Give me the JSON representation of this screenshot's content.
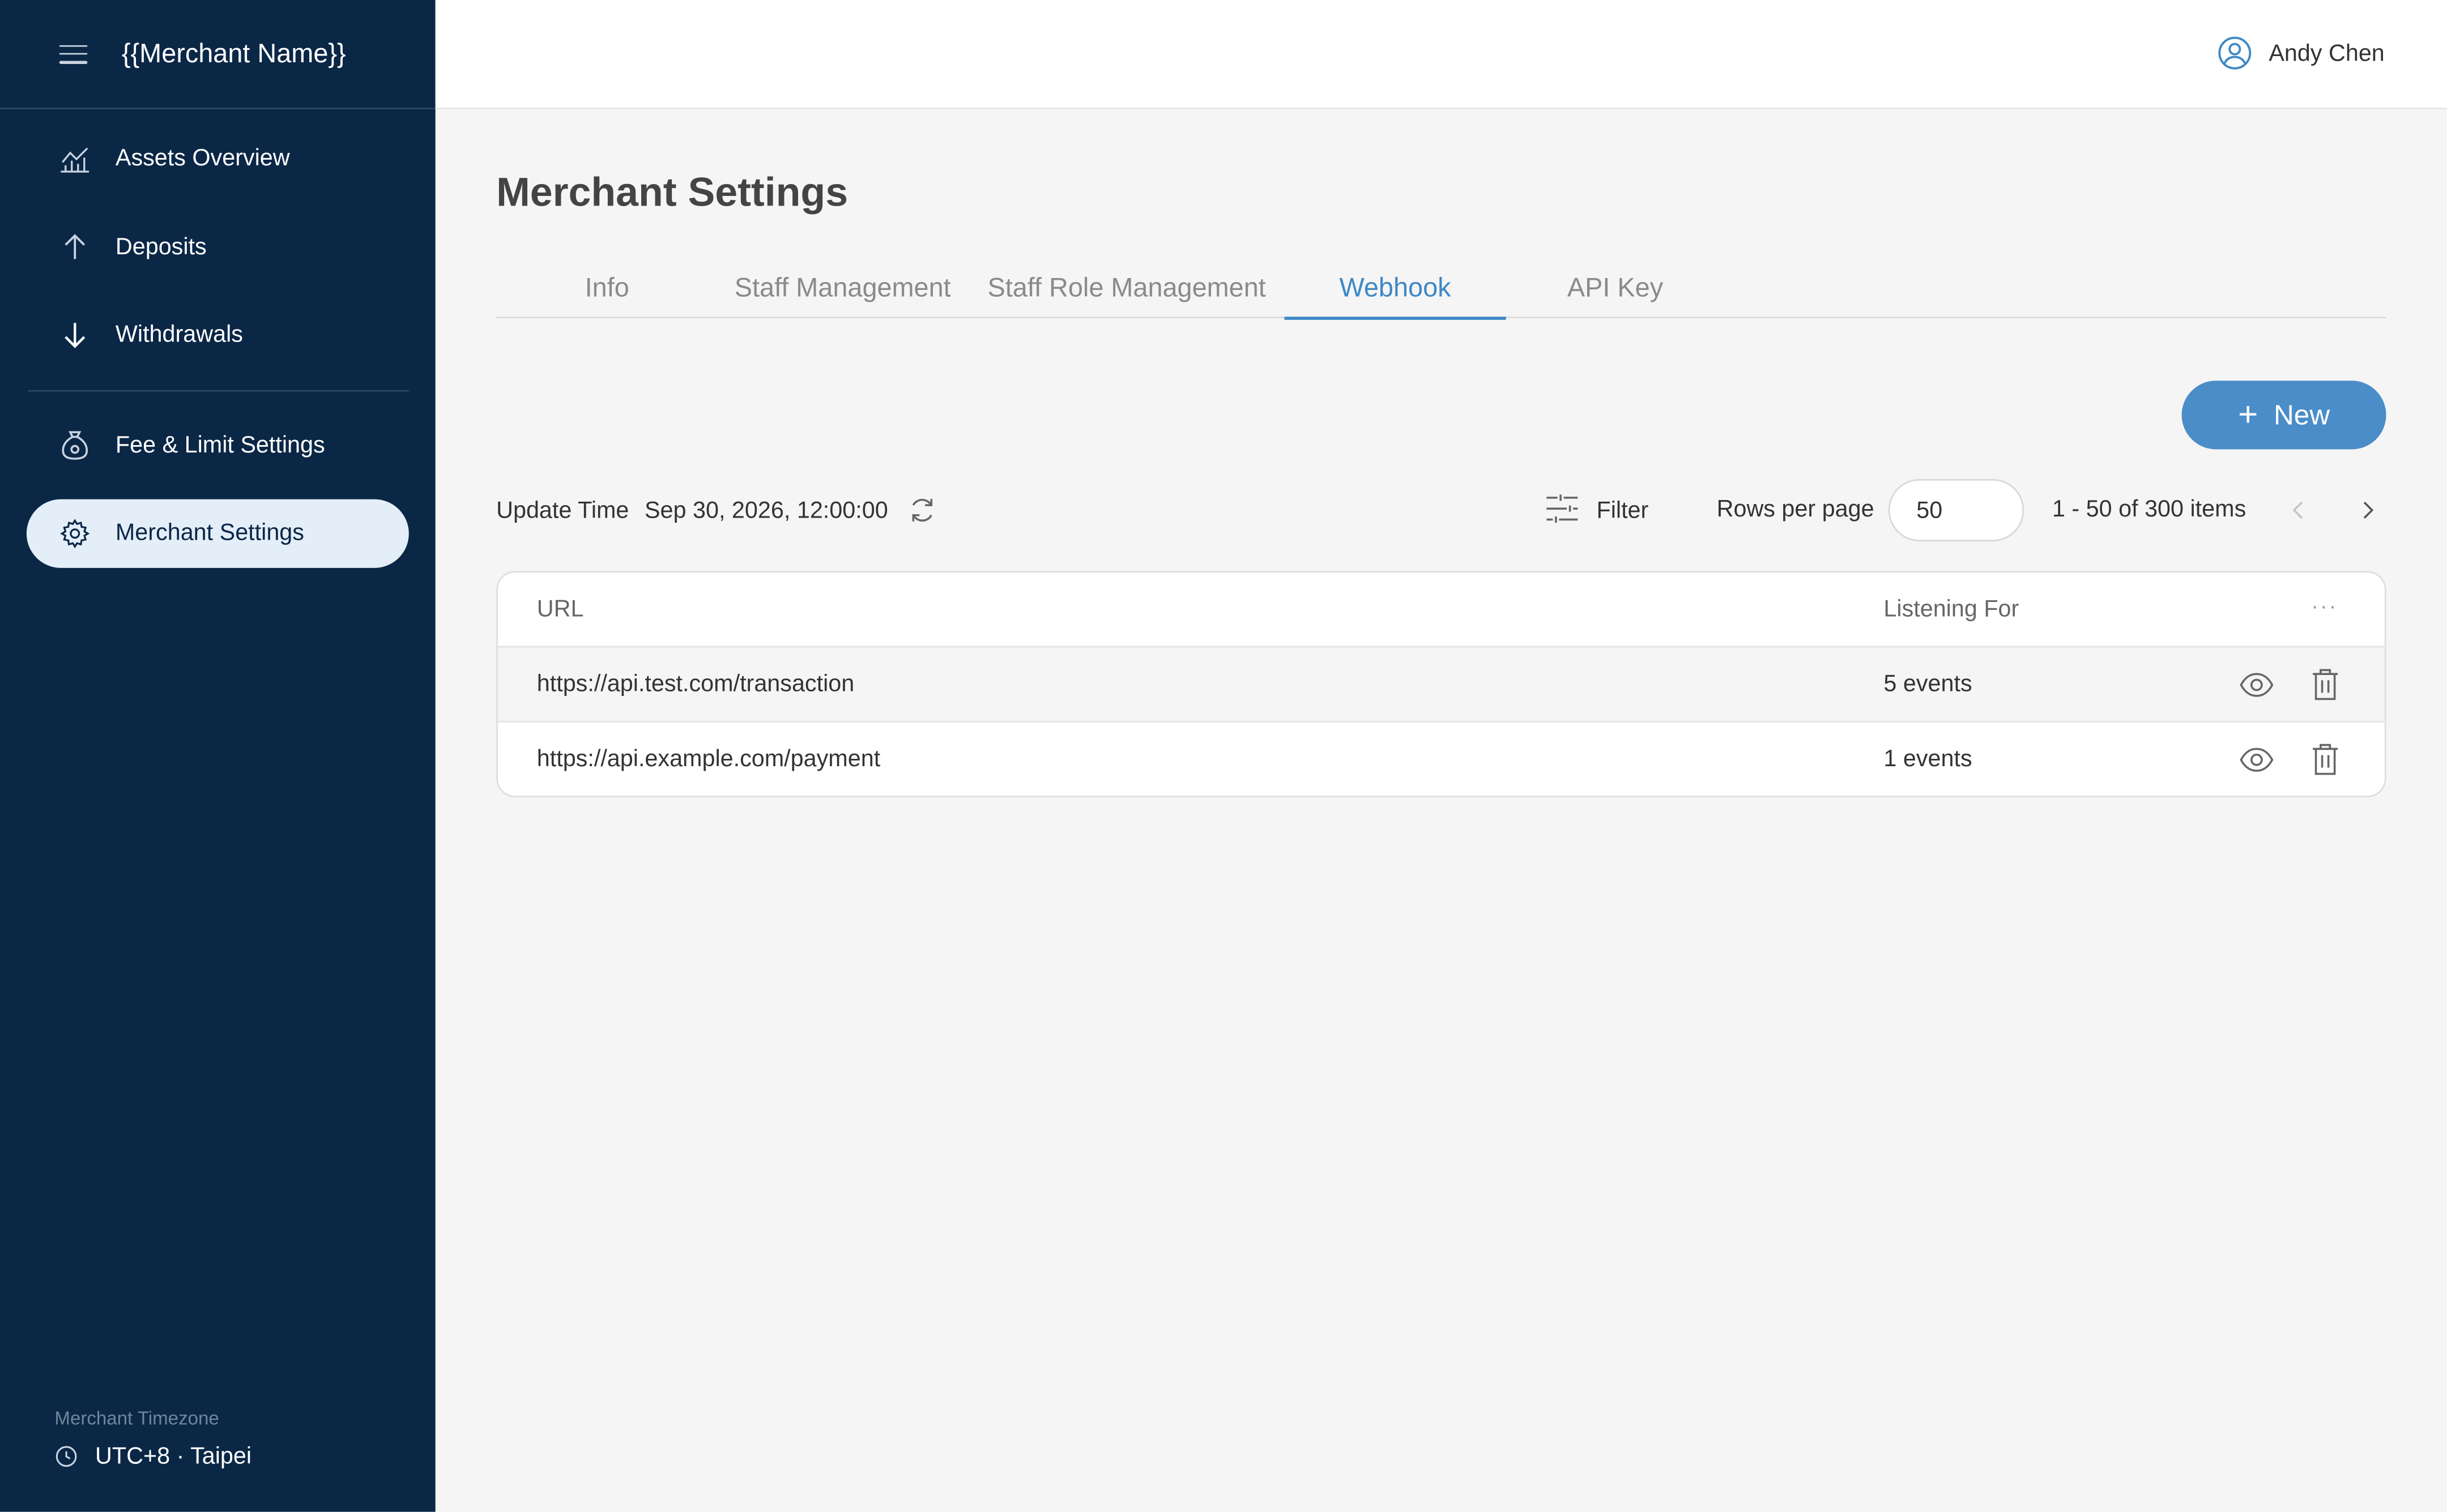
{
  "sidebar": {
    "merchant_name": "{{Merchant Name}}",
    "items": [
      {
        "label": "Assets Overview",
        "icon": "chart-icon"
      },
      {
        "label": "Deposits",
        "icon": "arrow-up-icon"
      },
      {
        "label": "Withdrawals",
        "icon": "arrow-down-icon"
      },
      {
        "label": "Fee & Limit Settings",
        "icon": "money-bag-icon"
      },
      {
        "label": "Merchant Settings",
        "icon": "gear-icon",
        "active": true
      }
    ],
    "timezone_label": "Merchant Timezone",
    "timezone_value": "UTC+8 · Taipei"
  },
  "topbar": {
    "user_name": "Andy Chen"
  },
  "page": {
    "title": "Merchant Settings",
    "tabs": [
      {
        "label": "Info"
      },
      {
        "label": "Staff Management"
      },
      {
        "label": "Staff Role Management"
      },
      {
        "label": "Webhook",
        "active": true
      },
      {
        "label": "API Key"
      }
    ],
    "new_button": "New"
  },
  "toolbar": {
    "update_label": "Update Time",
    "update_time": "Sep 30, 2026, 12:00:00",
    "filter_label": "Filter",
    "rows_label": "Rows per page",
    "rows_value": "50",
    "range": "1 - 50 of 300 items"
  },
  "table": {
    "headers": {
      "url": "URL",
      "listening": "Listening For",
      "more": "···"
    },
    "rows": [
      {
        "url": "https://api.test.com/transaction",
        "listening": "5 events"
      },
      {
        "url": "https://api.example.com/payment",
        "listening": "1 events"
      }
    ]
  },
  "colors": {
    "sidebar_bg": "#0b2746",
    "accent": "#3e88c6",
    "button_bg": "#4a8dc8",
    "active_nav_bg": "#e3eef8"
  }
}
